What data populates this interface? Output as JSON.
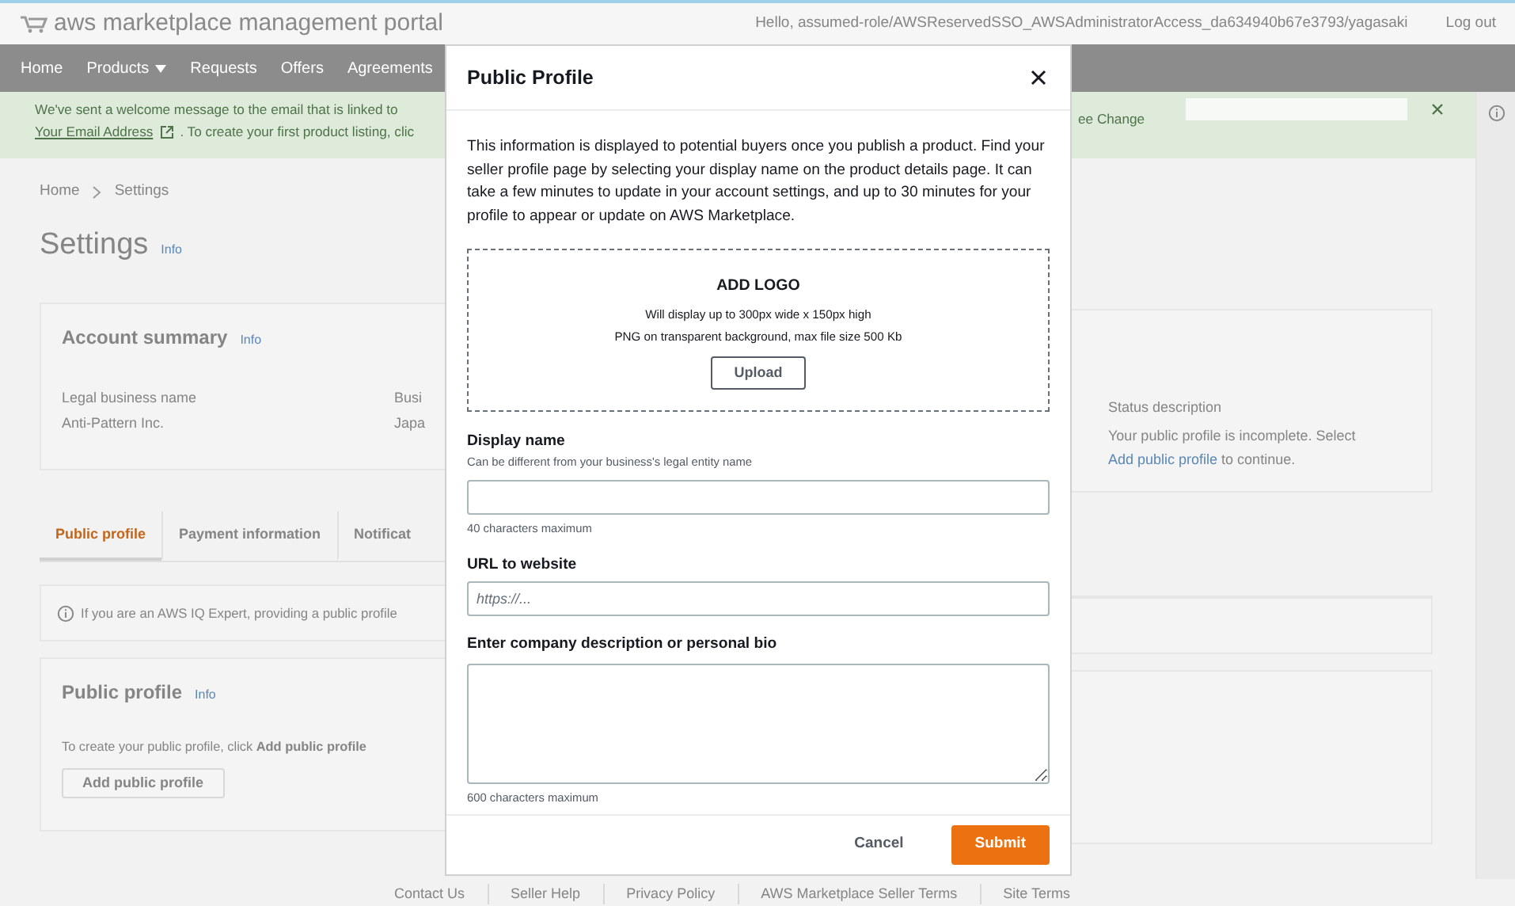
{
  "header": {
    "logo_text": "aws marketplace management portal",
    "greeting": "Hello, assumed-role/AWSReservedSSO_AWSAdministratorAccess_da634940b67e3793/yagasaki",
    "logout": "Log out"
  },
  "nav": [
    {
      "label": "Home",
      "dropdown": false
    },
    {
      "label": "Products",
      "dropdown": true
    },
    {
      "label": "Requests",
      "dropdown": false
    },
    {
      "label": "Offers",
      "dropdown": false
    },
    {
      "label": "Agreements",
      "dropdown": false
    }
  ],
  "banner": {
    "line_1": "We've sent a welcome message to the email that is linked to",
    "link": "Your Email Address",
    "line_2_rest": ". To create your first product listing, clic",
    "right_text": "ee Change"
  },
  "breadcrumb": [
    "Home",
    "Settings"
  ],
  "page_title": "Settings",
  "page_info": "Info",
  "account_summary": {
    "title": "Account summary",
    "info": "Info",
    "fields": [
      {
        "label": "Legal business name",
        "value": "Anti-Pattern Inc."
      },
      {
        "label": "Busi",
        "value": "Japa"
      }
    ],
    "status_label": "Status description",
    "status_text_before": "Your public profile is incomplete. Select",
    "status_link": "Add public profile",
    "status_text_after": "to continue."
  },
  "tabs": [
    {
      "label": "Public profile",
      "selected": true
    },
    {
      "label": "Payment information",
      "selected": false
    },
    {
      "label": "Notificat",
      "selected": false
    }
  ],
  "alert": {
    "text": "If you are an AWS IQ Expert, providing a public profile"
  },
  "public_profile": {
    "title": "Public profile",
    "info": "Info",
    "text": "To create your public profile, click **Add public profile**",
    "button": "Add public profile"
  },
  "modal": {
    "title": "Public Profile",
    "intro": "This information is displayed to potential buyers once you publish a product. Find your seller profile page by selecting your display name on the product details page. It can take a few minutes to update in your account settings, and up to 30 minutes for your profile to appear or update on AWS Marketplace.",
    "logo": {
      "title": "ADD LOGO",
      "lines": [
        "Will display up to 300px wide x 150px high",
        "PNG on transparent background, max file size 500 Kb"
      ],
      "button": "Upload"
    },
    "fields": [
      {
        "kind": "input",
        "label": "Display name",
        "hint": "Can be different from your business's legal entity name",
        "note": "40 characters maximum"
      },
      {
        "kind": "input",
        "label": "URL to website",
        "placeholder": "https://..."
      },
      {
        "kind": "textarea",
        "label": "Enter company description or personal bio",
        "note": "600 characters maximum"
      }
    ],
    "cancel": "Cancel",
    "submit": "Submit"
  },
  "footer": [
    "Contact Us",
    "Seller Help",
    "Privacy Policy",
    "AWS Marketplace Seller Terms",
    "Site Terms"
  ]
}
